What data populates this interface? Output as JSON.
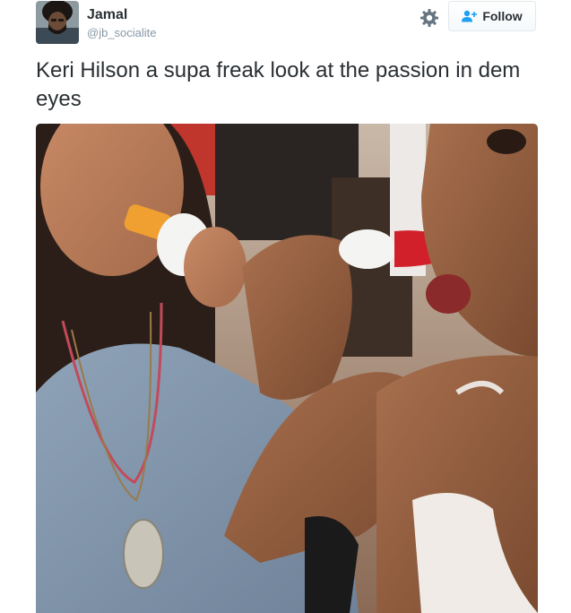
{
  "tweet": {
    "author": {
      "display_name": "Jamal",
      "screen_name": "@jb_socialite",
      "avatar_icon": "avatar-photo"
    },
    "actions": {
      "settings_icon": "gear-icon",
      "follow_icon": "add-user-icon",
      "follow_label": "Follow"
    },
    "text": "Keri Hilson a supa freak look at the passion in dem eyes",
    "colors": {
      "text": "#292f33",
      "secondary_text": "#8899a6",
      "follow_icon": "#1da1f2",
      "border": "#e1e8ed"
    }
  }
}
